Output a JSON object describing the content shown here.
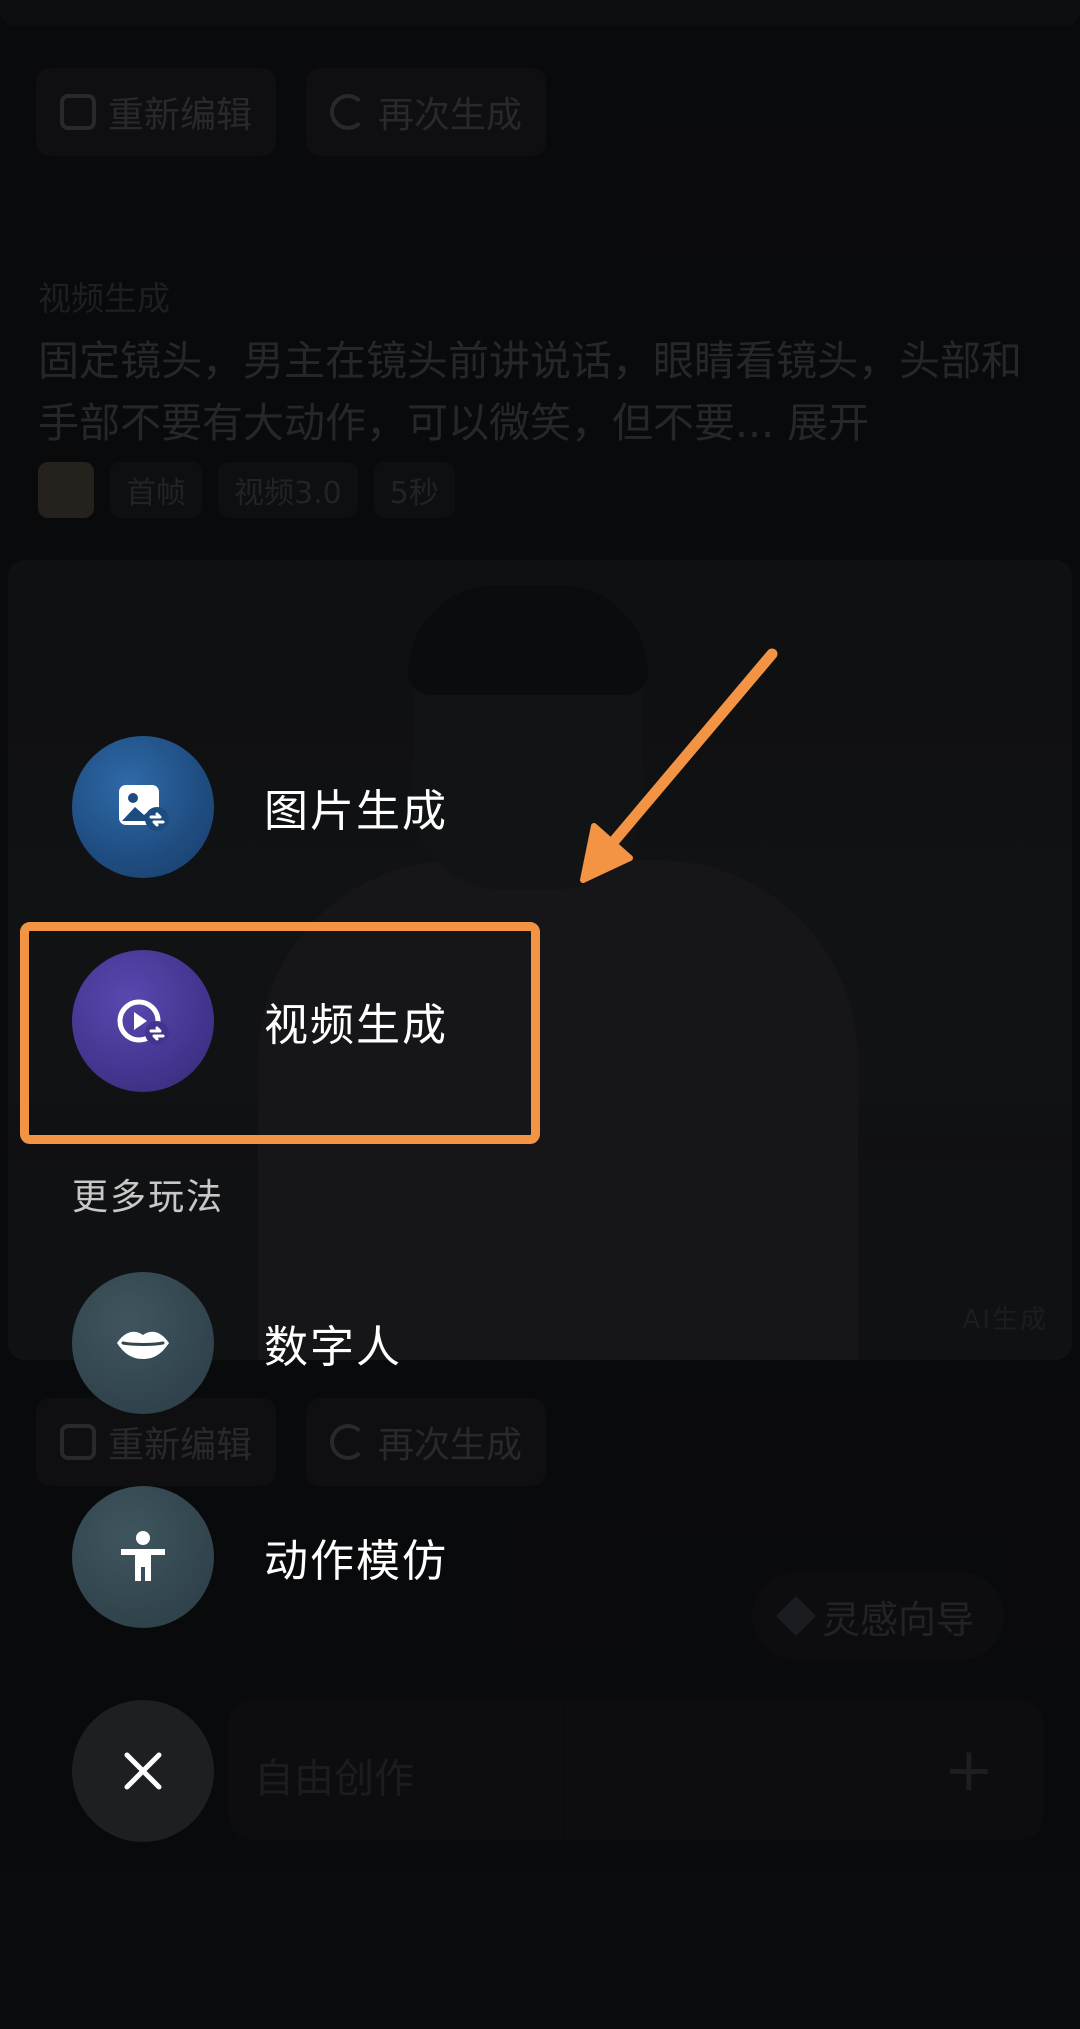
{
  "background": {
    "top_actions": [
      {
        "label": "重新编辑",
        "icon": "edit-icon"
      },
      {
        "label": "再次生成",
        "icon": "refresh-icon"
      }
    ],
    "section_label": "视频生成",
    "prompt_text": "固定镜头，男主在镜头前讲说话，眼睛看镜头，头部和手部不要有大动作，可以微笑，但不要...",
    "prompt_more": "展开",
    "meta_tags": [
      "首帧",
      "视频3.0",
      "5秒"
    ],
    "watermark": "AI生成",
    "bottom_actions": [
      {
        "label": "重新编辑",
        "icon": "edit-icon"
      },
      {
        "label": "再次生成",
        "icon": "refresh-icon"
      }
    ],
    "inspire_button": "灵感向导",
    "input_placeholder": "自由创作"
  },
  "menu": {
    "items": [
      {
        "label": "图片生成",
        "icon": "image-generate-icon"
      },
      {
        "label": "视频生成",
        "icon": "video-generate-icon"
      }
    ],
    "more_label": "更多玩法",
    "more_items": [
      {
        "label": "数字人",
        "icon": "lips-icon"
      },
      {
        "label": "动作模仿",
        "icon": "person-icon"
      }
    ],
    "close_icon": "close-icon"
  },
  "annotation": {
    "highlight_color": "#f39444"
  }
}
